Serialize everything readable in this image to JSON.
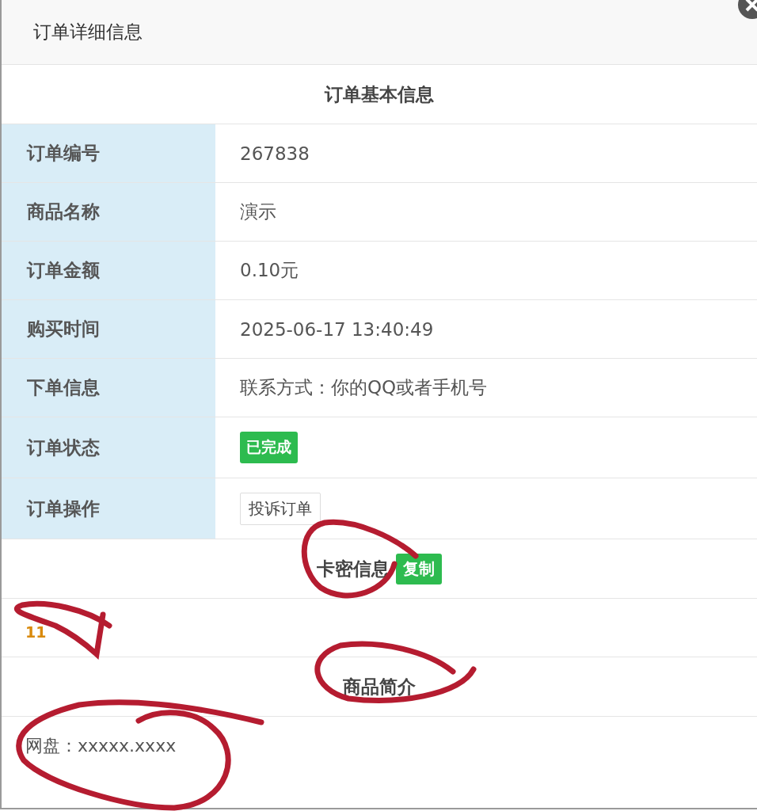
{
  "dialog": {
    "title": "订单详细信息"
  },
  "sections": [
    {
      "heading": "订单基本信息",
      "rows": [
        {
          "label": "订单编号",
          "kind": "text",
          "value": "267838"
        },
        {
          "label": "商品名称",
          "kind": "text",
          "value": "演示"
        },
        {
          "label": "订单金额",
          "kind": "text",
          "value": "0.10元"
        },
        {
          "label": "购买时间",
          "kind": "text",
          "value": "2025-06-17 13:40:49"
        },
        {
          "label": "下单信息",
          "kind": "text",
          "value": "联系方式：你的QQ或者手机号"
        },
        {
          "label": "订单状态",
          "kind": "badge",
          "value": "已完成"
        },
        {
          "label": "订单操作",
          "kind": "button",
          "value": "投诉订单"
        }
      ]
    },
    {
      "heading": "卡密信息",
      "action": "复制",
      "content": "11",
      "kind": "secret"
    },
    {
      "heading": "商品简介",
      "content": "网盘：xxxxx.xxxx",
      "kind": "text"
    }
  ]
}
